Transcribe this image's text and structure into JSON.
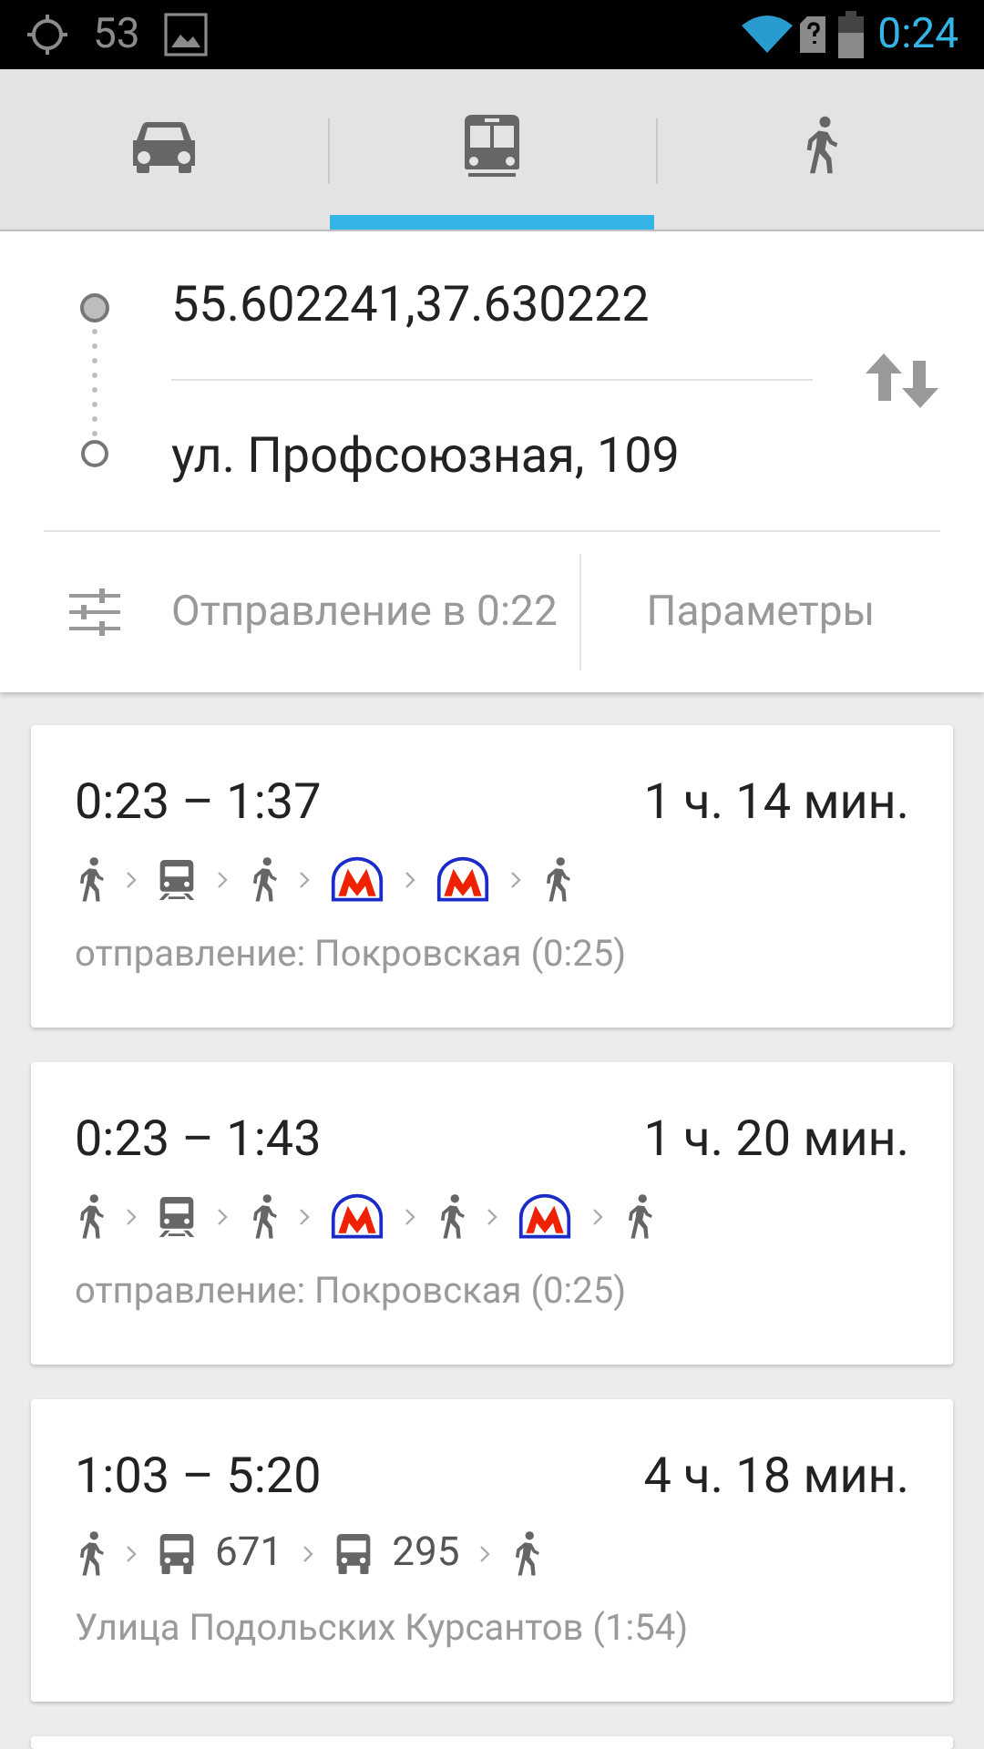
{
  "status_bar": {
    "notification_count": "53",
    "time": "0:24"
  },
  "tabs": [
    {
      "kind": "car",
      "selected": false
    },
    {
      "kind": "transit",
      "selected": true
    },
    {
      "kind": "walk",
      "selected": false
    }
  ],
  "route_form": {
    "origin": "55.602241,37.630222",
    "destination": "ул. Профсоюзная, 109",
    "departure": "Отправление в 0:22",
    "options_button": "Параметры"
  },
  "routes": [
    {
      "times": "0:23 – 1:37",
      "duration": "1 ч. 14 мин.",
      "steps": [
        {
          "kind": "walk"
        },
        {
          "kind": "train"
        },
        {
          "kind": "walk"
        },
        {
          "kind": "metro"
        },
        {
          "kind": "metro"
        },
        {
          "kind": "walk"
        }
      ],
      "note": "отправление: Покровская (0:25)"
    },
    {
      "times": "0:23 – 1:43",
      "duration": "1 ч. 20 мин.",
      "steps": [
        {
          "kind": "walk"
        },
        {
          "kind": "train"
        },
        {
          "kind": "walk"
        },
        {
          "kind": "metro"
        },
        {
          "kind": "walk"
        },
        {
          "kind": "metro"
        },
        {
          "kind": "walk"
        }
      ],
      "note": "отправление: Покровская (0:25)"
    },
    {
      "times": "1:03 – 5:20",
      "duration": "4 ч. 18 мин.",
      "steps": [
        {
          "kind": "walk"
        },
        {
          "kind": "bus",
          "label": "671"
        },
        {
          "kind": "bus",
          "label": "295"
        },
        {
          "kind": "walk"
        }
      ],
      "note": "Улица Подольских Курсантов (1:54)"
    }
  ]
}
